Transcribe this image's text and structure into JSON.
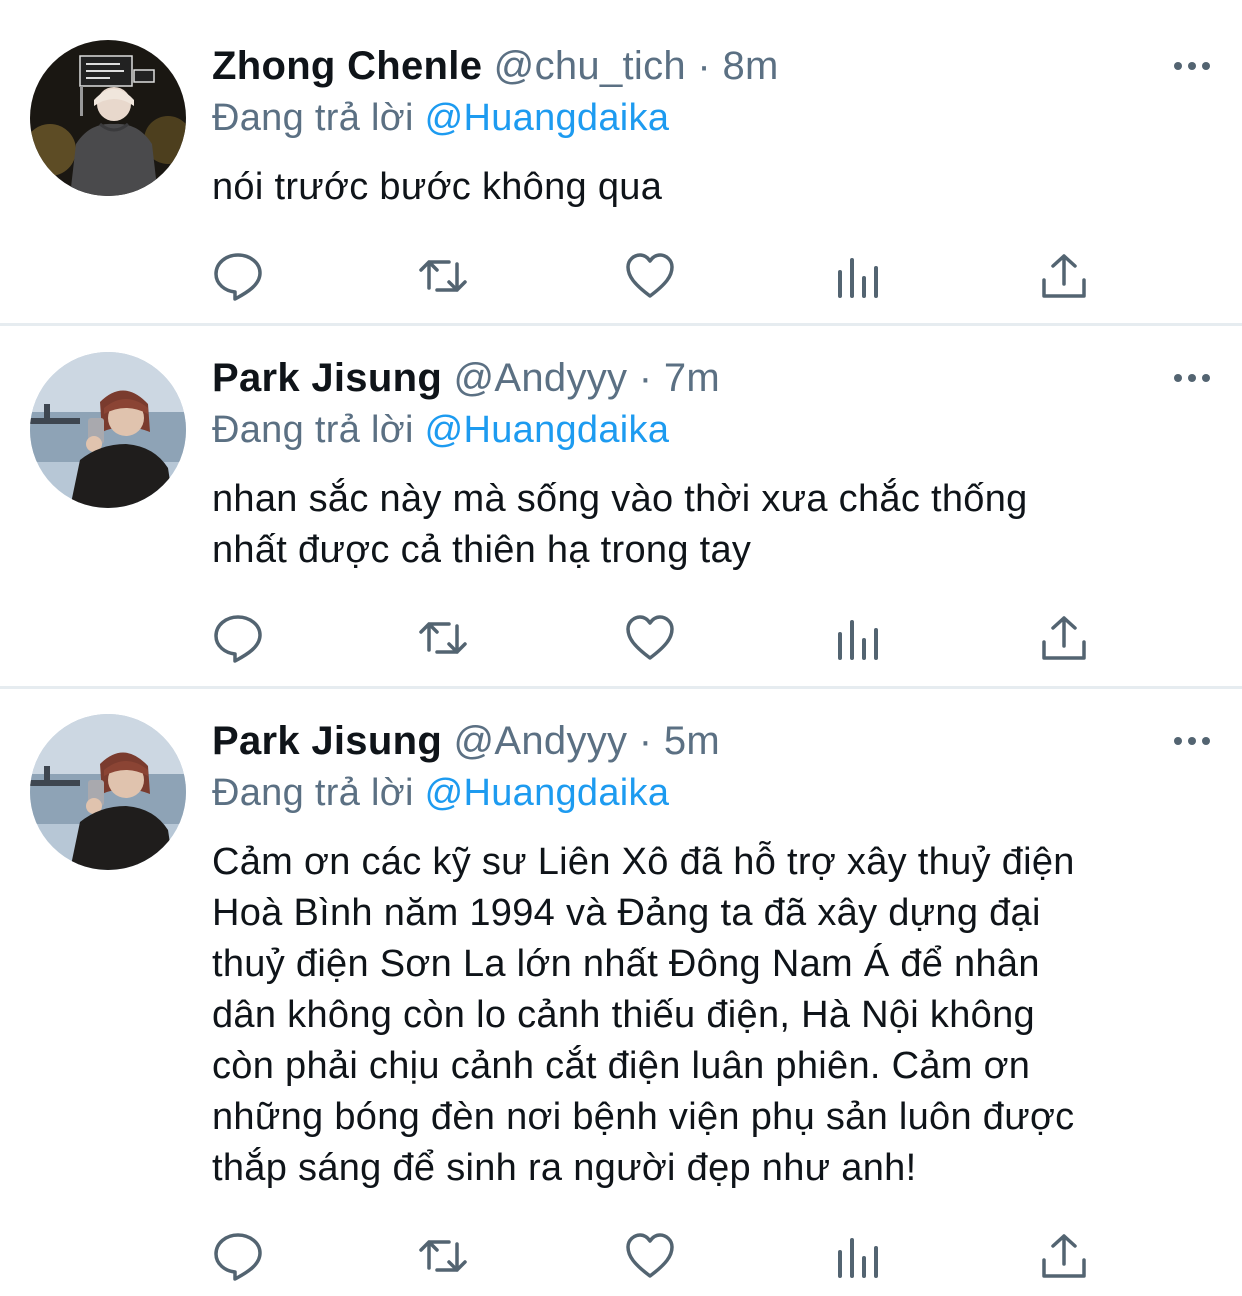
{
  "tweets": [
    {
      "name": "Zhong Chenle",
      "handle": "@chu_tich",
      "separator": "·",
      "time": "8m",
      "reply_prefix": "Đang trả lời",
      "reply_to": "@Huangdaika",
      "text_lines": [
        "nói trước bước không qua"
      ],
      "avatar": "avatar-night-street"
    },
    {
      "name": "Park Jisung",
      "handle": "@Andyyy",
      "separator": "·",
      "time": "7m",
      "reply_prefix": "Đang trả lời",
      "reply_to": "@Huangdaika",
      "text_lines": [
        "nhan sắc này mà sống vào thời xưa chắc thống",
        "nhất được cả thiên hạ trong tay"
      ],
      "avatar": "avatar-seaside"
    },
    {
      "name": "Park Jisung",
      "handle": "@Andyyy",
      "separator": "·",
      "time": "5m",
      "reply_prefix": "Đang trả lời",
      "reply_to": "@Huangdaika",
      "text_lines": [
        "Cảm ơn các kỹ sư Liên Xô đã hỗ trợ xây thuỷ điện",
        "Hoà Bình năm 1994 và Đảng ta đã xây dựng đại",
        "thuỷ điện Sơn La lớn nhất Đông Nam Á để nhân",
        "dân không còn lo cảnh thiếu điện, Hà Nội không",
        "còn phải chịu cảnh cắt điện luân phiên. Cảm ơn",
        "những bóng đèn nơi bệnh viện phụ sản luôn được",
        "thắp sáng để sinh ra người đẹp như anh!"
      ],
      "avatar": "avatar-seaside"
    }
  ],
  "icons": {
    "reply": "speech-bubble-icon",
    "retweet": "retweet-arrows-icon",
    "like": "heart-icon",
    "analytics": "bar-chart-icon",
    "share": "share-upload-icon",
    "more": "three-dots-icon"
  },
  "colors": {
    "text": "#0f1419",
    "muted": "#5b7083",
    "link": "#1d9bf0",
    "icon": "#536471",
    "divider": "#e6ecf0"
  }
}
